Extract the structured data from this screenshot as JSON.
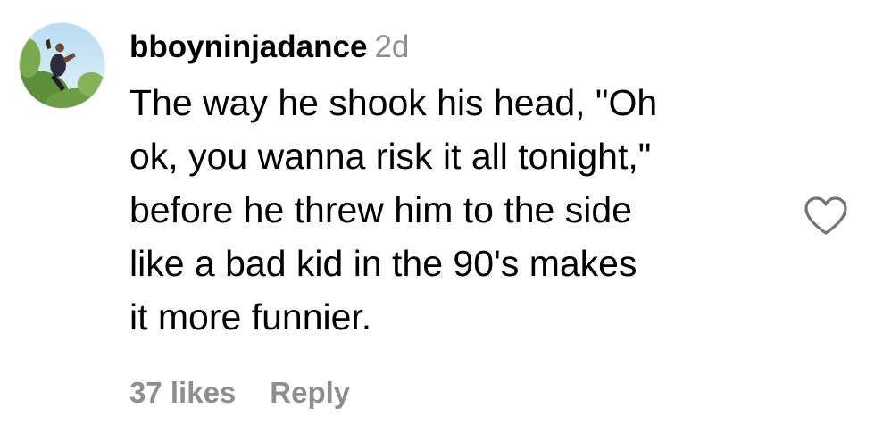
{
  "comment": {
    "username": "bboyninjadance",
    "time": "2d",
    "text": "The way he shook his head, \"Oh\nok, you wanna risk it all tonight,\"\nbefore he threw him to the side\nlike a bad kid in the 90's makes\nit more funnier.",
    "likes_label": "37 likes",
    "reply_label": "Reply",
    "avatar_icon": "profile-photo",
    "like_icon": "heart-outline-icon"
  },
  "colors": {
    "text": "#000000",
    "secondary": "#8e8e8e",
    "background": "#ffffff"
  }
}
